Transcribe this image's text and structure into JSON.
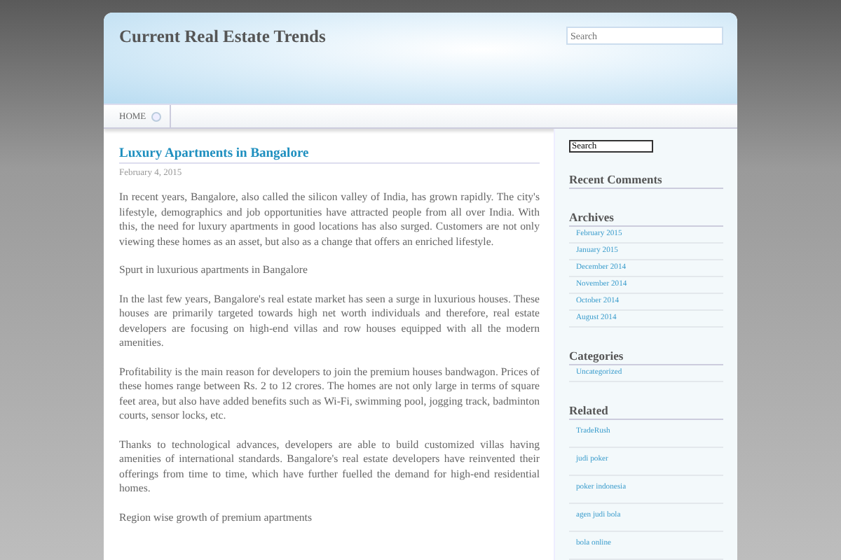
{
  "site_title": "Current Real Estate Trends",
  "header_search": {
    "placeholder": "Search"
  },
  "nav": [
    {
      "label": "HOME",
      "selected": true
    }
  ],
  "post": {
    "title": "Luxury Apartments in Bangalore",
    "date": "February 4, 2015",
    "paragraphs": [
      "In recent years, Bangalore, also called the silicon valley of India, has grown rapidly. The city's lifestyle, demographics and job opportunities have attracted people from all over India. With this, the need for luxury apartments in good locations has also surged. Customers are not only viewing these homes as an asset, but also as a change that offers an enriched lifestyle.",
      "Spurt in luxurious apartments in Bangalore",
      "In the last few years, Bangalore's real estate market has seen a surge in luxurious houses. These houses are primarily targeted towards high net worth individuals and therefore, real estate developers are focusing on high-end villas and row houses equipped with all the modern amenities.",
      "Profitability is the main reason for developers to join the premium houses bandwagon. Prices of these homes range between Rs. 2 to 12 crores. The homes are not only large in terms of square feet area, but also have added benefits such as Wi-Fi, swimming pool, jogging track, badminton courts, sensor locks, etc.",
      "Thanks to technological advances, developers are able to build customized villas having amenities of international standards. Bangalore's real estate developers have reinvented their offerings from time to time, which have further fuelled the demand for high-end residential homes.",
      "Region wise growth of premium apartments"
    ]
  },
  "sidebar": {
    "search": {
      "value": "Search"
    },
    "widgets": [
      {
        "title": "Recent Comments"
      },
      {
        "title": "Archives",
        "kind": "compact",
        "items": [
          "February 2015",
          "January 2015",
          "December 2014",
          "November 2014",
          "October 2014",
          "August 2014"
        ]
      },
      {
        "title": "Categories",
        "kind": "compact",
        "items": [
          "Uncategorized"
        ]
      },
      {
        "title": "Related",
        "kind": "spaced",
        "items": [
          "TradeRush",
          "judi poker",
          "poker indonesia",
          "agen judi bola",
          "bola online"
        ]
      }
    ]
  }
}
